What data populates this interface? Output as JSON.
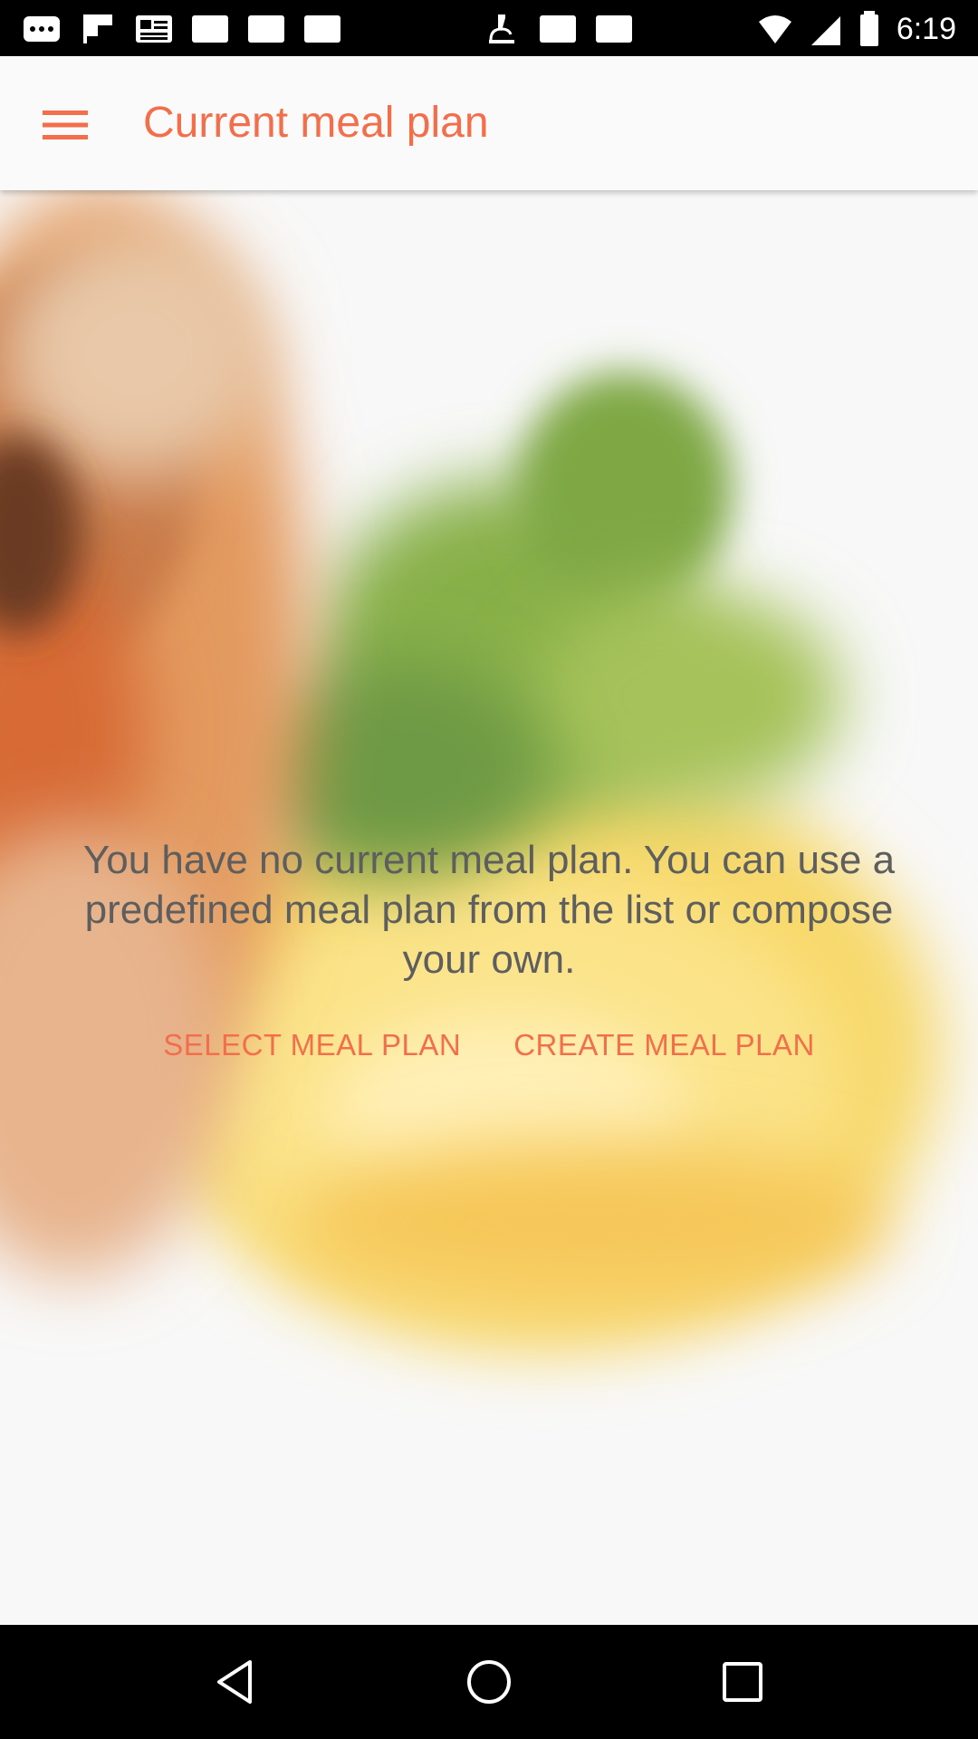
{
  "status_bar": {
    "time": "6:19",
    "notification_icons": [
      "more-icon",
      "flipboard-icon",
      "news-icon",
      "square-icon",
      "square-icon",
      "square-icon",
      "microscope-icon",
      "square-icon",
      "square-icon"
    ]
  },
  "app_bar": {
    "title": "Current meal plan",
    "menu_icon": "hamburger-menu-icon"
  },
  "main": {
    "empty_message": "You have no current meal plan. You can use a predefined meal plan from the list or compose your own.",
    "select_button": "SELECT MEAL PLAN",
    "create_button": "CREATE MEAL PLAN"
  },
  "colors": {
    "accent": "#f36f4b",
    "text_secondary": "#5e5e5e",
    "app_bar_bg": "#fafafa"
  },
  "nav_bar": {
    "back_icon": "back-triangle-icon",
    "home_icon": "home-circle-icon",
    "recents_icon": "recents-square-icon"
  }
}
